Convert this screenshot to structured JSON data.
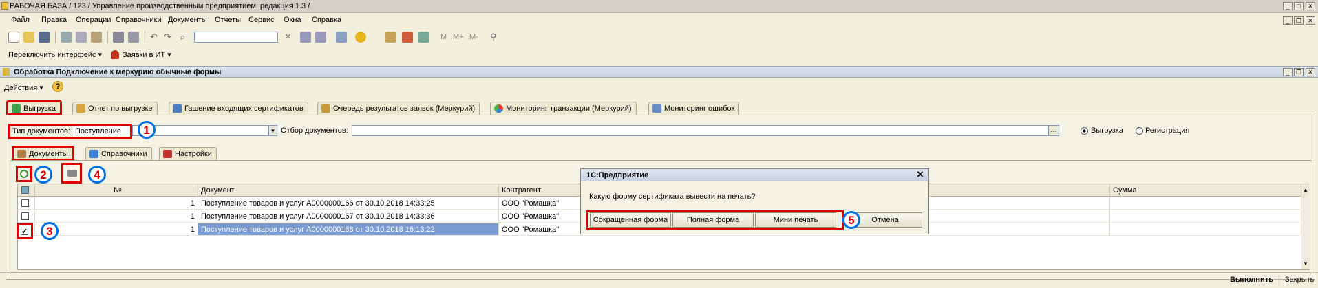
{
  "window": {
    "title": "РАБОЧАЯ БАЗА / 123 /  Управление производственным предприятием, редакция 1.3 /"
  },
  "menu": [
    "Файл",
    "Правка",
    "Операции",
    "Справочники",
    "Документы",
    "Отчеты",
    "Сервис",
    "Окна",
    "Справка"
  ],
  "toolbar2": {
    "interface": "Переключить интерфейс",
    "requests": "Заявки в ИТ"
  },
  "form": {
    "title": "Обработка  Подключение к меркурию обычные формы",
    "actions": "Действия"
  },
  "tabs_top": [
    "Выгрузка",
    "Отчет по выгрузке",
    "Гашение входящих сертификатов",
    "Очередь результатов заявок (Меркурий)",
    "Мониторинг транзакции (Меркурий)",
    "Мониторинг ошибок"
  ],
  "filters": {
    "doc_type_label": "Тип документов:",
    "doc_type_value": "Поступление",
    "selection_label": "Отбор документов:",
    "selection_value": "",
    "radio_export": "Выгрузка",
    "radio_register": "Регистрация",
    "selected_radio": "Выгрузка"
  },
  "tabs_inner": [
    "Документы",
    "Справочники",
    "Настройки"
  ],
  "table": {
    "columns": {
      "num": "№",
      "doc": "Документ",
      "counterparty": "Контрагент",
      "sum": "Сумма"
    },
    "rows": [
      {
        "checked": false,
        "num": "1",
        "doc": "Поступление товаров и услуг А0000000166 от 30.10.2018 14:33:25",
        "counterparty": "ООО \"Ромашка\"",
        "selected": false
      },
      {
        "checked": false,
        "num": "1",
        "doc": "Поступление товаров и услуг А0000000167 от 30.10.2018 14:33:36",
        "counterparty": "ООО \"Ромашка\"",
        "selected": false
      },
      {
        "checked": true,
        "num": "1",
        "doc": "Поступление товаров и услуг А0000000168 от 30.10.2018 16:13:22",
        "counterparty": "ООО \"Ромашка\"",
        "selected": true
      }
    ]
  },
  "dialog": {
    "title": "1С:Предприятие",
    "question": "Какую форму сертификата вывести на печать?",
    "buttons": [
      "Сокращенная форма",
      "Полная форма",
      "Мини печать",
      "Отмена"
    ]
  },
  "badges": [
    "1",
    "2",
    "3",
    "4",
    "5"
  ],
  "footer": {
    "run": "Выполнить",
    "close": "Закрыть"
  },
  "colors": {
    "annotation_red": "#e00000",
    "annotation_blue": "#0070e0",
    "selection": "#7a9cd3"
  }
}
